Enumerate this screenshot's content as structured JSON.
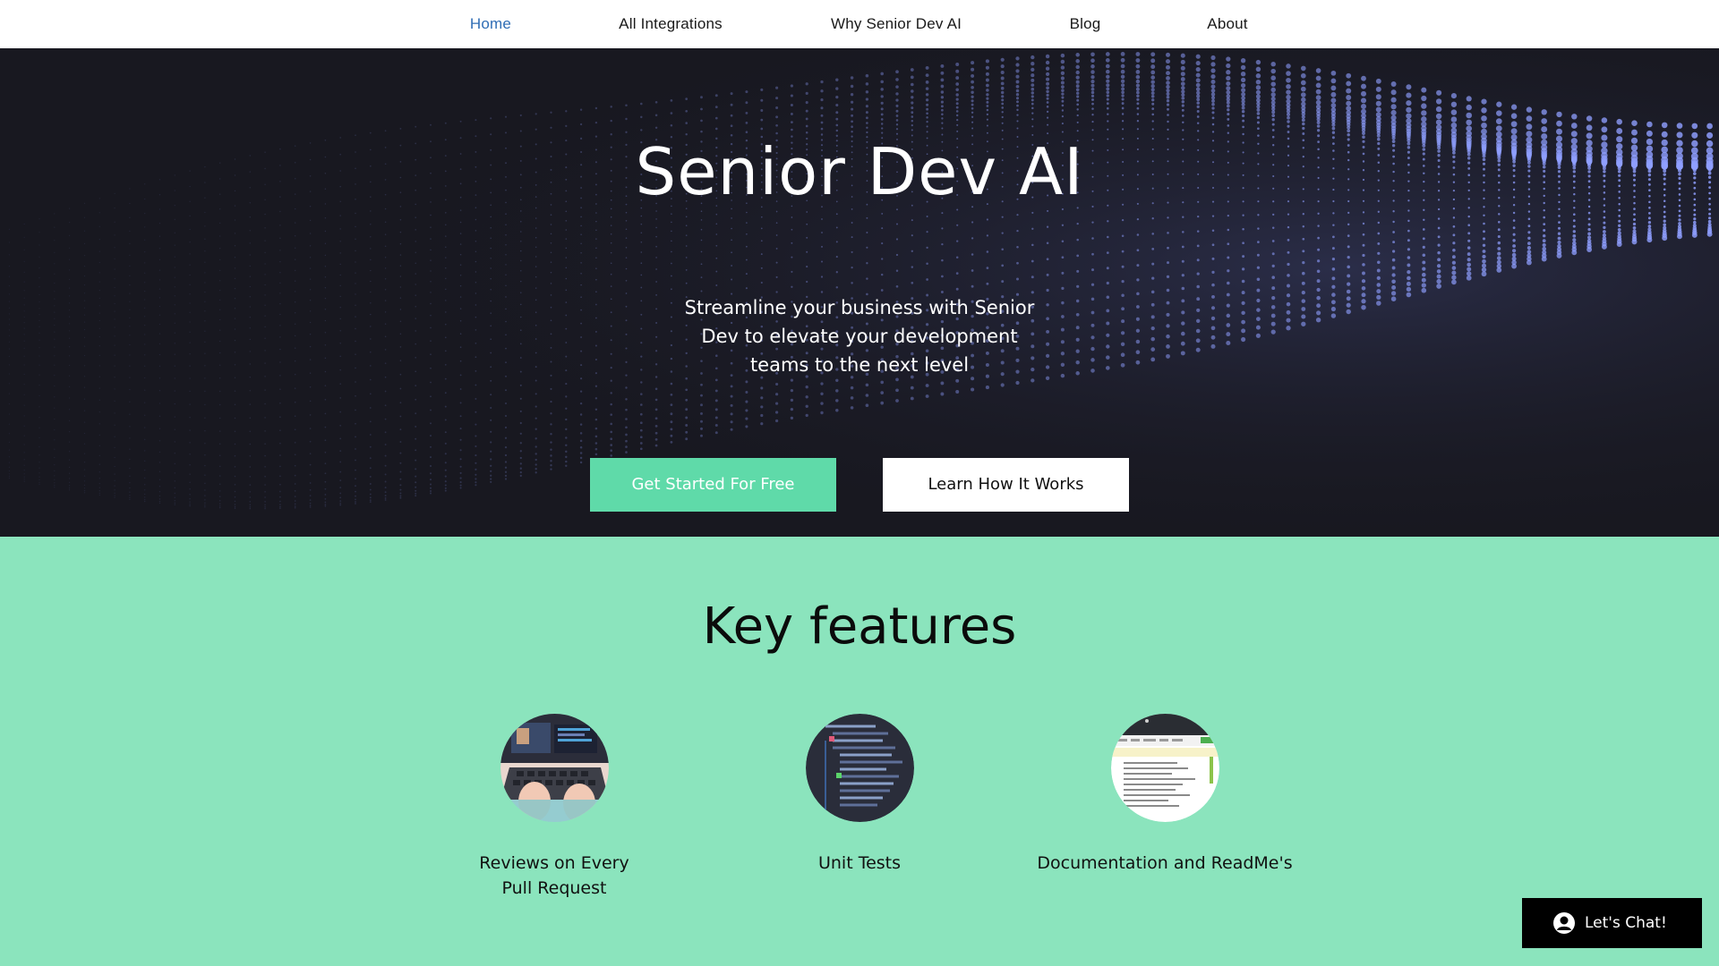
{
  "nav": {
    "items": [
      {
        "label": "Home",
        "active": true
      },
      {
        "label": "All Integrations",
        "active": false
      },
      {
        "label": "Why Senior Dev AI",
        "active": false
      },
      {
        "label": "Blog",
        "active": false
      },
      {
        "label": "About",
        "active": false
      }
    ],
    "active_color": "#2f6db5"
  },
  "hero": {
    "title": "Senior Dev AI",
    "subtitle": "Streamline your business with Senior Dev to elevate your development teams to the next level",
    "primary_button": "Get Started For Free",
    "secondary_button": "Learn How It Works",
    "background_color": "#181820",
    "accent_dot_color": "#8f9fff"
  },
  "features": {
    "title": "Key features",
    "background_color": "#8be4bd",
    "items": [
      {
        "label": "Reviews on Every Pull Request",
        "icon": "laptop-photo-icon"
      },
      {
        "label": "Unit Tests",
        "icon": "code-photo-icon"
      },
      {
        "label": "Documentation and ReadMe's",
        "icon": "document-photo-icon"
      }
    ]
  },
  "chat": {
    "label": "Let's Chat!",
    "icon": "user-avatar-icon"
  },
  "colors": {
    "primary_button": "#5fdaa9",
    "brand_green": "#8be4bd"
  }
}
